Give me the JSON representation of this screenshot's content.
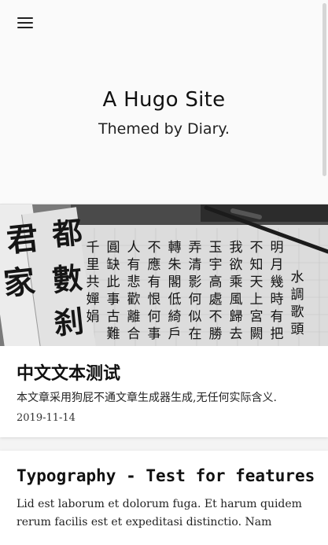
{
  "header": {
    "menu_icon": "hamburger-menu-icon",
    "site_title": "A Hugo Site",
    "site_subtitle": "Themed by Diary."
  },
  "posts": [
    {
      "title": "中文文本测试",
      "summary": "本文章采用狗屁不通文章生成器生成,无任何实际含义.",
      "date": "2019-11-14",
      "cover": {
        "kind": "calligraphy-photo",
        "left_chars": [
          "君",
          "家",
          "都",
          "數",
          "刹"
        ],
        "poem_title": "水調歌頭",
        "columns": [
          "明月幾時有把酒問青天",
          "不知天上宮闕今夕是何年",
          "我欲乘風歸去又恐瓊樓",
          "玉宇高處不勝寒起舞",
          "弄清影何似在人間",
          "轉朱閣低綺戶照無眠",
          "不應有恨何事長向別時圓",
          "人有悲歡離合月有陰晴",
          "圓缺此事古難全但願人長久",
          "千里共嬋娟"
        ]
      }
    },
    {
      "title": "Typography - Test for features",
      "summary": "Lid est laborum et dolorum fuga. Et harum quidem rerum facilis est et expeditasi distinctio. Nam"
    }
  ]
}
